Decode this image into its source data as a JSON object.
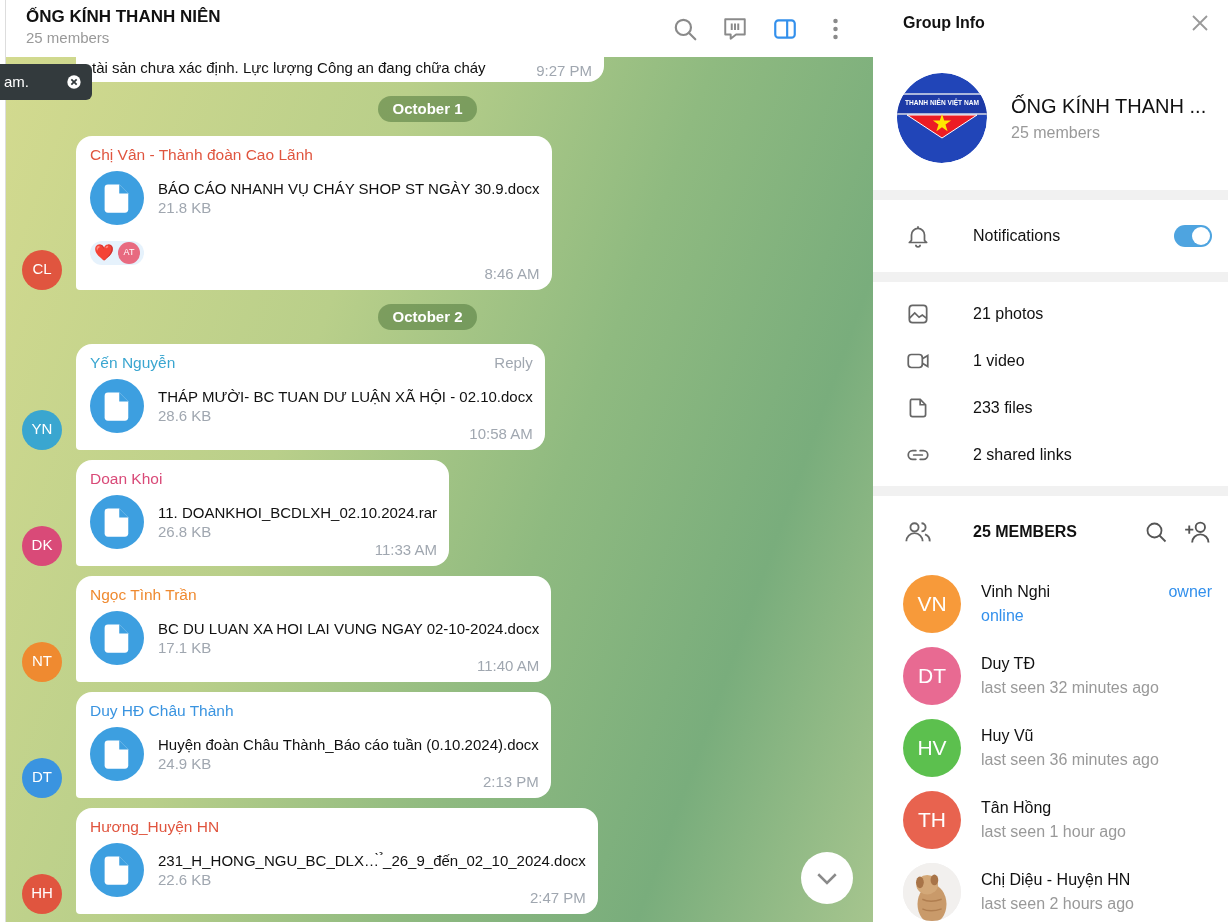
{
  "chat": {
    "title": "ỐNG KÍNH THANH NIÊN",
    "subtitle": "25 members",
    "tools": [
      {
        "kind": "search",
        "selected": false
      },
      {
        "kind": "poll",
        "selected": false
      },
      {
        "kind": "sidebar",
        "selected": true
      },
      {
        "kind": "more",
        "selected": false
      }
    ],
    "toast": {
      "text": "am."
    },
    "items": [
      {
        "kind": "partial",
        "text": "tài sản chưa xác định. Lực lượng Công an đang chữa cháy",
        "time": "9:27 PM"
      },
      {
        "kind": "date",
        "text": "October 1"
      },
      {
        "kind": "file",
        "sender": "Chị Vân - Thành đoàn Cao Lãnh",
        "initials": "CL",
        "color": "#e0553f",
        "file": "BÁO CÁO NHANH VỤ CHÁY SHOP ST NGÀY 30.9.docx",
        "size": "21.8 KB",
        "time": "8:46 AM",
        "reaction": {
          "emoji": "❤️",
          "initials": "AT"
        }
      },
      {
        "kind": "date",
        "text": "October 2"
      },
      {
        "kind": "file",
        "sender": "Yến Nguyễn",
        "initials": "YN",
        "color": "#3aa6d0",
        "file": "THÁP MƯỜI- BC TUAN DƯ LUẬN XÃ HỘI - 02.10.docx",
        "size": "28.6 KB",
        "time": "10:58 AM",
        "reply": "Reply"
      },
      {
        "kind": "file",
        "sender": "Doan Khoi",
        "initials": "DK",
        "color": "#d94a78",
        "file": "11. DOANKHOI_BCDLXH_02.10.2024.rar",
        "size": "26.8 KB",
        "time": "11:33 AM"
      },
      {
        "kind": "file",
        "sender": "Ngọc Tình Trần",
        "initials": "NT",
        "color": "#ef8a30",
        "file": "BC DU LUAN XA HOI LAI VUNG NGAY 02-10-2024.docx",
        "size": "17.1 KB",
        "time": "11:40 AM"
      },
      {
        "kind": "file",
        "sender": "Duy HĐ Châu Thành",
        "initials": "DT",
        "color": "#3a94e0",
        "file": "Huyện đoàn Châu Thành_Báo cáo tuần (0.10.2024).docx",
        "size": "24.9 KB",
        "time": "2:13 PM"
      },
      {
        "kind": "file",
        "sender": "Hương_Huyện HN",
        "initials": "HH",
        "color": "#e0553f",
        "file": "231_H_HONG_NGU_BC_DLX…̀ ̉_26_9_đến_02_10_2024.docx",
        "size": "22.6 KB",
        "time": "2:47 PM"
      }
    ]
  },
  "info": {
    "title": "Group Info",
    "logo_text": "THANH NIÊN VIỆT NAM",
    "name": "ỐNG KÍNH THANH ...",
    "subtitle": "25 members",
    "notifications": {
      "label": "Notifications",
      "on": true
    },
    "media": [
      {
        "kind": "photos",
        "label": "21 photos"
      },
      {
        "kind": "video",
        "label": "1 video"
      },
      {
        "kind": "files",
        "label": "233 files"
      },
      {
        "kind": "links",
        "label": "2 shared links"
      }
    ],
    "members_title": "25 MEMBERS",
    "members": [
      {
        "initials": "VN",
        "color": "#f79a3a",
        "name": "Vinh Nghi",
        "status": "online",
        "online": true,
        "role": "owner"
      },
      {
        "initials": "DT",
        "color": "#e86a92",
        "name": "Duy TĐ",
        "status": "last seen 32 minutes ago",
        "online": false
      },
      {
        "initials": "HV",
        "color": "#5cc04e",
        "name": "Huy Vũ",
        "status": "last seen 36 minutes ago",
        "online": false
      },
      {
        "initials": "TH",
        "color": "#e8634f",
        "name": "Tân Hồng",
        "status": "last seen 1 hour ago",
        "online": false
      },
      {
        "kind": "picture",
        "name": "Chị Diệu - Huyện HN",
        "status": "last seen 2 hours ago",
        "online": false
      }
    ]
  }
}
